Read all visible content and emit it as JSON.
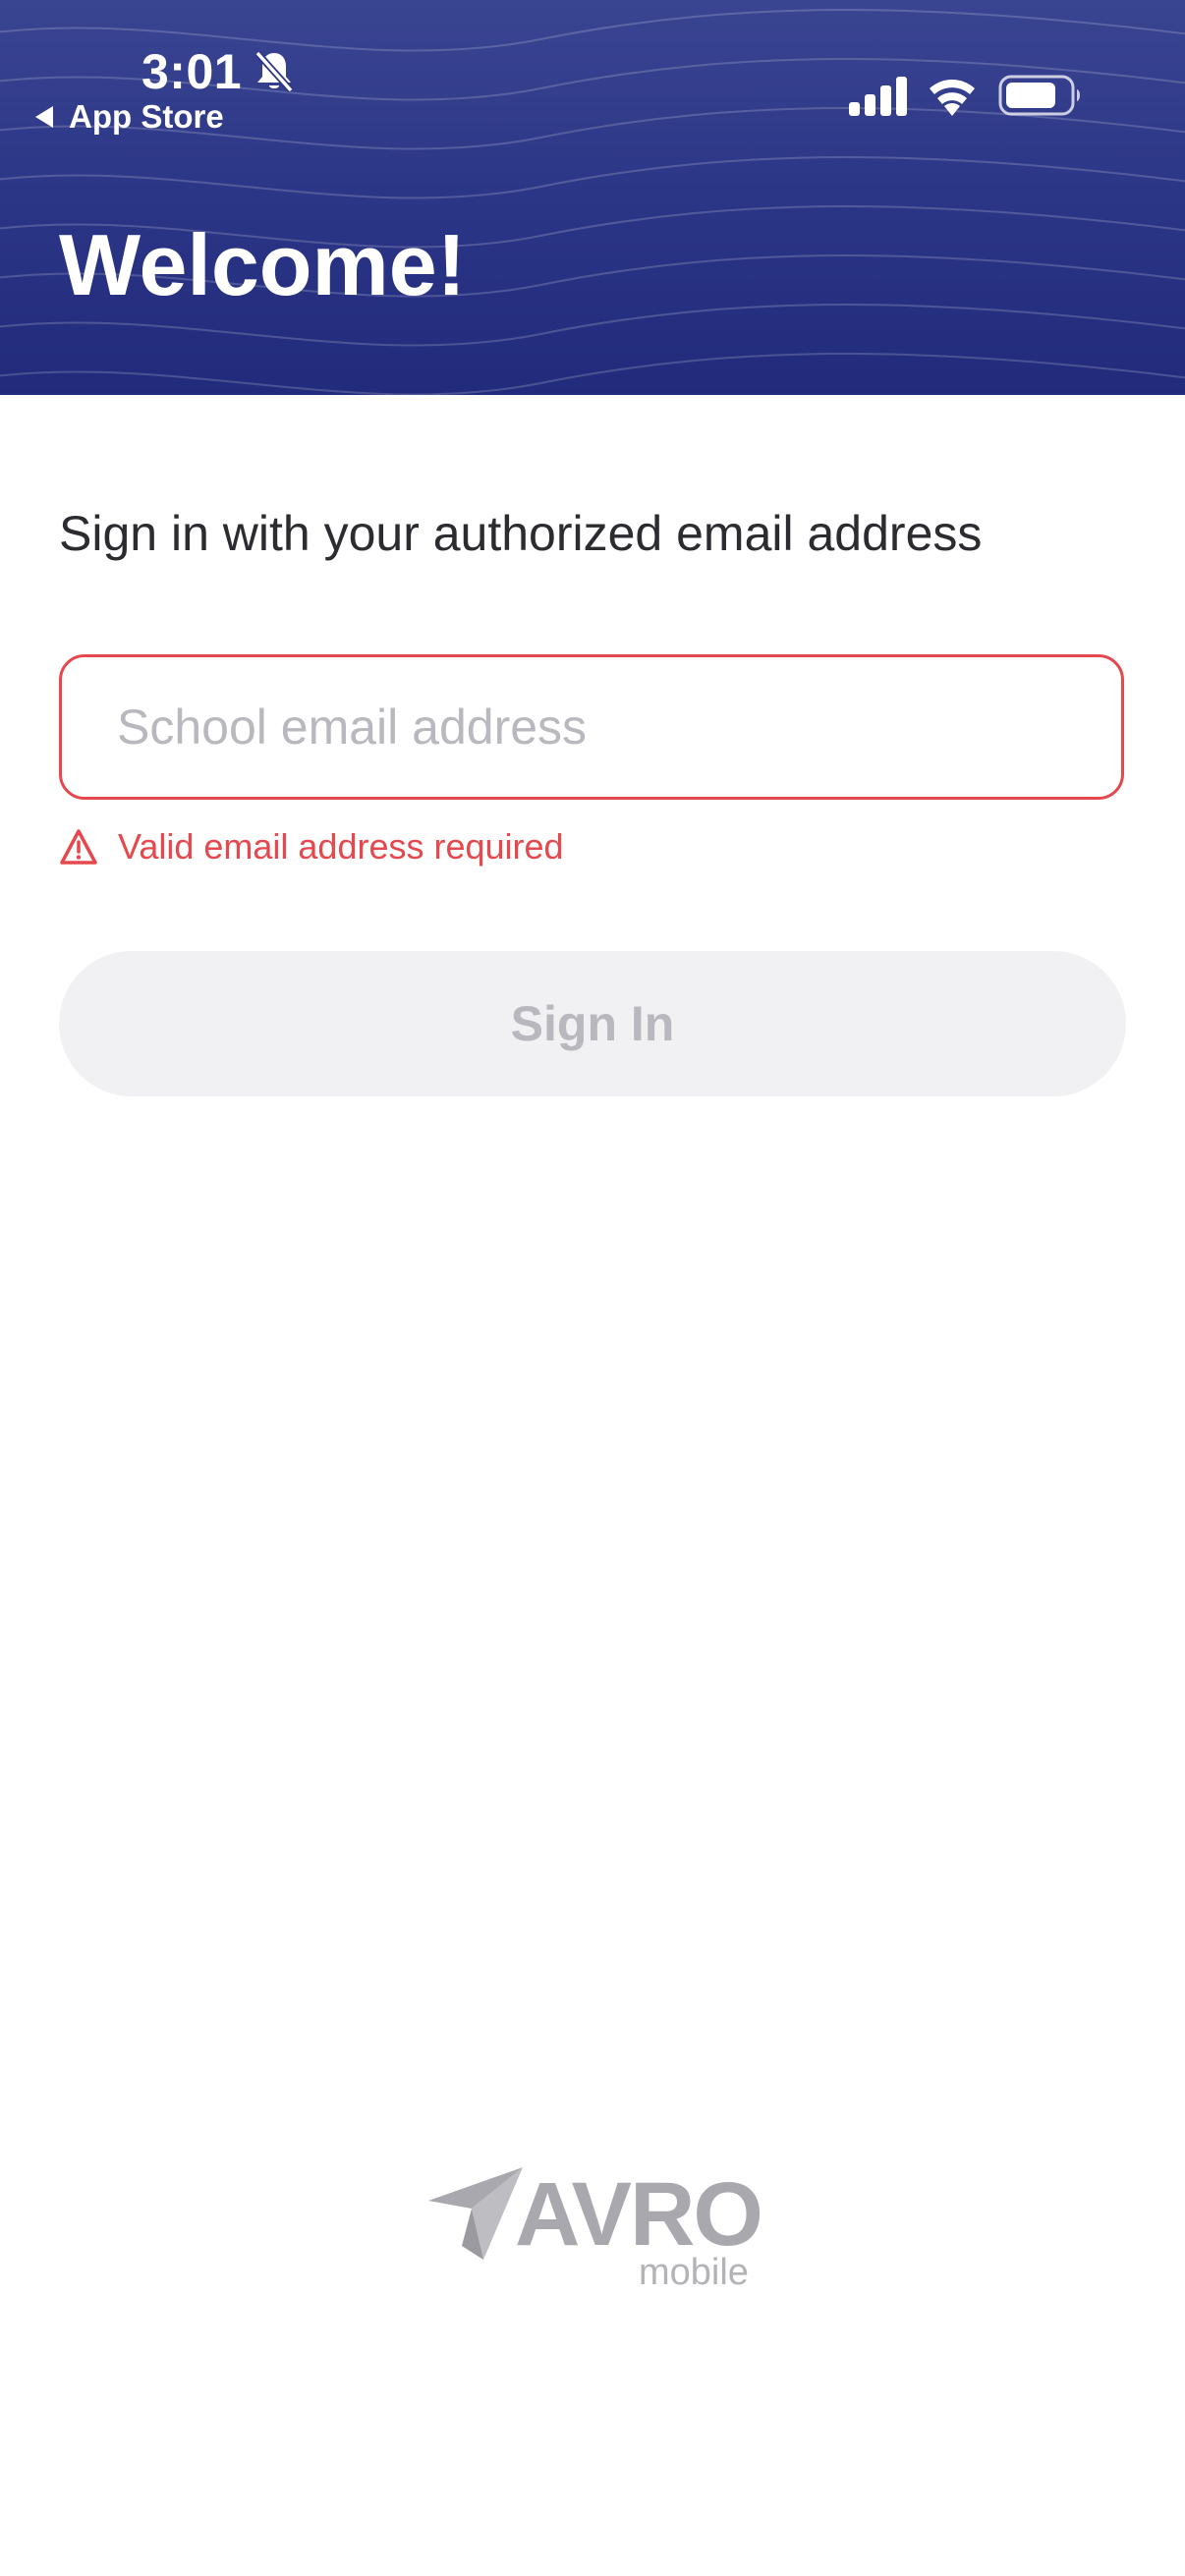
{
  "status_bar": {
    "time": "3:01",
    "back_label": "App Store"
  },
  "header": {
    "title": "Welcome!"
  },
  "signin": {
    "instruction": "Sign in with your authorized email address",
    "email_value": "",
    "email_placeholder": "School email address",
    "error_message": "Valid email address required",
    "button_label": "Sign In"
  },
  "footer": {
    "brand_name": "AVRO",
    "brand_sub": "mobile"
  },
  "colors": {
    "header_bg": "#2d3787",
    "error": "#e5484d",
    "button_disabled_bg": "#f1f1f4",
    "button_disabled_text": "#b8b8be"
  },
  "icons": {
    "bell": "bell-slash-icon",
    "signal": "cellular-signal-icon",
    "wifi": "wifi-icon",
    "battery": "battery-icon",
    "warning": "warning-triangle-icon",
    "back": "back-triangle-icon",
    "logo": "paper-plane-icon"
  }
}
